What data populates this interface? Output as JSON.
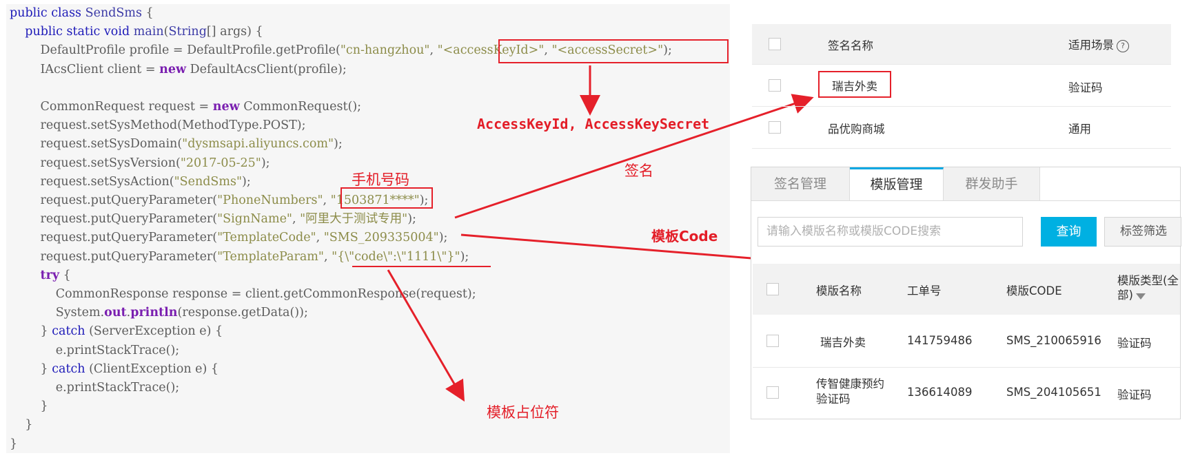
{
  "code": {
    "lines": [
      [
        {
          "t": "public class ",
          "c": "kw"
        },
        {
          "t": "SendSms",
          "c": "ty"
        },
        {
          "t": " {",
          "c": ""
        }
      ],
      [
        {
          "t": "    public static void ",
          "c": "kw"
        },
        {
          "t": "main",
          "c": "ty"
        },
        {
          "t": "(",
          "c": ""
        },
        {
          "t": "String",
          "c": "ty"
        },
        {
          "t": "[] args) {",
          "c": ""
        }
      ],
      [
        {
          "t": "        DefaultProfile profile = DefaultProfile.getProfile(",
          "c": ""
        },
        {
          "t": "\"cn-hangzhou\"",
          "c": "str"
        },
        {
          "t": ", ",
          "c": ""
        },
        {
          "t": "\"<accessKeyId>\"",
          "c": "str"
        },
        {
          "t": ", ",
          "c": ""
        },
        {
          "t": "\"<accessSecret>\"",
          "c": "str"
        },
        {
          "t": ");",
          "c": ""
        }
      ],
      [
        {
          "t": "        IAcsClient client = ",
          "c": ""
        },
        {
          "t": "new",
          "c": "kwb"
        },
        {
          "t": " DefaultAcsClient(profile);",
          "c": ""
        }
      ],
      [
        {
          "t": "",
          "c": ""
        }
      ],
      [
        {
          "t": "        CommonRequest request = ",
          "c": ""
        },
        {
          "t": "new",
          "c": "kwb"
        },
        {
          "t": " CommonRequest();",
          "c": ""
        }
      ],
      [
        {
          "t": "        request.setSysMethod(MethodType.POST);",
          "c": ""
        }
      ],
      [
        {
          "t": "        request.setSysDomain(",
          "c": ""
        },
        {
          "t": "\"dysmsapi.aliyuncs.com\"",
          "c": "str"
        },
        {
          "t": ");",
          "c": ""
        }
      ],
      [
        {
          "t": "        request.setSysVersion(",
          "c": ""
        },
        {
          "t": "\"2017-05-25\"",
          "c": "str"
        },
        {
          "t": ");",
          "c": ""
        }
      ],
      [
        {
          "t": "        request.setSysAction(",
          "c": ""
        },
        {
          "t": "\"SendSms\"",
          "c": "str"
        },
        {
          "t": ");",
          "c": ""
        }
      ],
      [
        {
          "t": "        request.putQueryParameter(",
          "c": ""
        },
        {
          "t": "\"PhoneNumbers\"",
          "c": "str"
        },
        {
          "t": ", ",
          "c": ""
        },
        {
          "t": "\"1503871****\"",
          "c": "str"
        },
        {
          "t": ");",
          "c": ""
        }
      ],
      [
        {
          "t": "        request.putQueryParameter(",
          "c": ""
        },
        {
          "t": "\"SignName\"",
          "c": "str"
        },
        {
          "t": ", ",
          "c": ""
        },
        {
          "t": "\"阿里大于测试专用\"",
          "c": "str"
        },
        {
          "t": ");",
          "c": ""
        }
      ],
      [
        {
          "t": "        request.putQueryParameter(",
          "c": ""
        },
        {
          "t": "\"TemplateCode\"",
          "c": "str"
        },
        {
          "t": ", ",
          "c": ""
        },
        {
          "t": "\"SMS_209335004\"",
          "c": "str"
        },
        {
          "t": ");",
          "c": ""
        }
      ],
      [
        {
          "t": "        request.putQueryParameter(",
          "c": ""
        },
        {
          "t": "\"TemplateParam\"",
          "c": "str"
        },
        {
          "t": ", ",
          "c": ""
        },
        {
          "t": "\"{\\\"code\\\":\\\"1111\\\"}\"",
          "c": "str"
        },
        {
          "t": ");",
          "c": ""
        }
      ],
      [
        {
          "t": "        ",
          "c": ""
        },
        {
          "t": "try",
          "c": "kwb"
        },
        {
          "t": " {",
          "c": ""
        }
      ],
      [
        {
          "t": "            CommonResponse response = client.getCommonResponse(request);",
          "c": ""
        }
      ],
      [
        {
          "t": "            System.",
          "c": ""
        },
        {
          "t": "out",
          "c": "kwb"
        },
        {
          "t": ".",
          "c": ""
        },
        {
          "t": "println",
          "c": "kwb"
        },
        {
          "t": "(response.getData());",
          "c": ""
        }
      ],
      [
        {
          "t": "        } ",
          "c": ""
        },
        {
          "t": "catch",
          "c": "kw"
        },
        {
          "t": " (ServerException e) {",
          "c": ""
        }
      ],
      [
        {
          "t": "            e.printStackTrace();",
          "c": ""
        }
      ],
      [
        {
          "t": "        } ",
          "c": ""
        },
        {
          "t": "catch",
          "c": "kw"
        },
        {
          "t": " (ClientException e) {",
          "c": ""
        }
      ],
      [
        {
          "t": "            e.printStackTrace();",
          "c": ""
        }
      ],
      [
        {
          "t": "        }",
          "c": ""
        }
      ],
      [
        {
          "t": "    }",
          "c": ""
        }
      ],
      [
        {
          "t": "}",
          "c": ""
        }
      ]
    ]
  },
  "annotations": {
    "access_key": "AccessKeyId, AccessKeySecret",
    "phone": "手机号码",
    "sign": "签名",
    "template_code": "模板Code",
    "placeholder": "模板占位符"
  },
  "sign_table": {
    "col_name": "签名名称",
    "col_scene": "适用场景",
    "help_icon": "?",
    "rows": [
      {
        "name": "瑞吉外卖",
        "scene": "验证码"
      },
      {
        "name": "品优购商城",
        "scene": "通用"
      }
    ]
  },
  "template_panel": {
    "tabs": [
      "签名管理",
      "模版管理",
      "群发助手"
    ],
    "active_tab": 1,
    "search_placeholder": "请输入模版名称或模版CODE搜索",
    "query_button": "查询",
    "tag_filter_button": "标签筛选",
    "headers": {
      "name": "模版名称",
      "order": "工单号",
      "code": "模版CODE",
      "type_line1": "模版类型(全",
      "type_line2": "部)"
    },
    "rows": [
      {
        "name": "瑞吉外卖",
        "order": "141759486",
        "code": "SMS_210065916",
        "type": "验证码"
      },
      {
        "name_line1": "传智健康预约",
        "name_line2": "验证码",
        "order": "136614089",
        "code": "SMS_204105651",
        "type": "验证码"
      }
    ]
  },
  "colors": {
    "annotation_red": "#e31d27",
    "query_button_bg": "#00b0e2",
    "active_tab_accent": "#00a7e3"
  }
}
